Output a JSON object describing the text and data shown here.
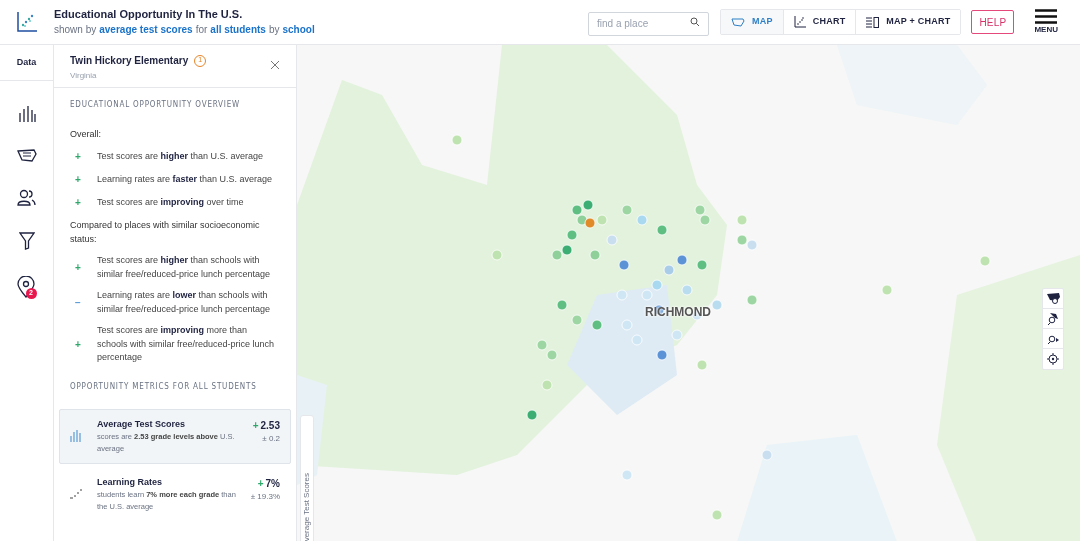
{
  "header": {
    "title": "Educational Opportunity In The U.S.",
    "subtitle": [
      {
        "kind": "text",
        "text": "shown by"
      },
      {
        "kind": "link",
        "text": "average test scores"
      },
      {
        "kind": "text",
        "text": "for"
      },
      {
        "kind": "link",
        "text": "all students"
      },
      {
        "kind": "text",
        "text": "by"
      },
      {
        "kind": "link",
        "text": "school"
      }
    ]
  },
  "search": {
    "placeholder": "find a place"
  },
  "view_tabs": [
    {
      "label": "MAP",
      "kind": "map",
      "selected": true
    },
    {
      "label": "CHART",
      "kind": "chart",
      "selected": false
    },
    {
      "label": "MAP + CHART",
      "kind": "split",
      "selected": false
    }
  ],
  "help": "HELP",
  "menu": "MENU",
  "rail": {
    "data_tab": "Data",
    "items": [
      {
        "kind": "bars"
      },
      {
        "kind": "map"
      },
      {
        "kind": "people"
      },
      {
        "kind": "filter"
      },
      {
        "kind": "pin",
        "badge": "2"
      }
    ]
  },
  "panel": {
    "name": "Twin Hickory Elementary",
    "badge": "1",
    "state": "Virginia",
    "overview_heading": "EDUCATIONAL OPPORTUNITY OVERVIEW",
    "groups": [
      {
        "label": "Overall:",
        "items": [
          {
            "kind": "positive",
            "sign": "+",
            "text": "Test scores are **higher** than U.S. average"
          },
          {
            "kind": "positive",
            "sign": "+",
            "text": "Learning rates are **faster** than U.S. average"
          },
          {
            "kind": "positive",
            "sign": "+",
            "text": "Test scores are **improving** over time"
          }
        ]
      },
      {
        "label": "Compared to places with similar socioeconomic status:",
        "items": [
          {
            "kind": "positive",
            "sign": "+",
            "text": "Test scores are **higher** than schools with similar free/reduced-price lunch percentage"
          },
          {
            "kind": "negative",
            "sign": "−",
            "text": "Learning rates are **lower** than schools with similar free/reduced-price lunch percentage"
          },
          {
            "kind": "positive",
            "sign": "+",
            "text": "Test scores are **improving** more than schools with similar free/reduced-price lunch percentage"
          }
        ]
      }
    ],
    "metrics_heading": "OPPORTUNITY METRICS FOR ALL STUDENTS",
    "metrics": [
      {
        "kind": "bars",
        "selected": true,
        "title": "Average Test Scores",
        "description": "scores are **2.53 grade levels above** U.S. average",
        "sign": "+",
        "value": "2.53",
        "error": "± 0.2"
      },
      {
        "kind": "steps",
        "selected": false,
        "title": "Learning Rates",
        "description": "students learn **7% more each grade** than the U.S. average",
        "sign": "+",
        "value": "7%",
        "error": "± 19.3%"
      }
    ]
  },
  "map": {
    "place_label": "RICHMOND",
    "side_tab": "verage Test Scores"
  }
}
